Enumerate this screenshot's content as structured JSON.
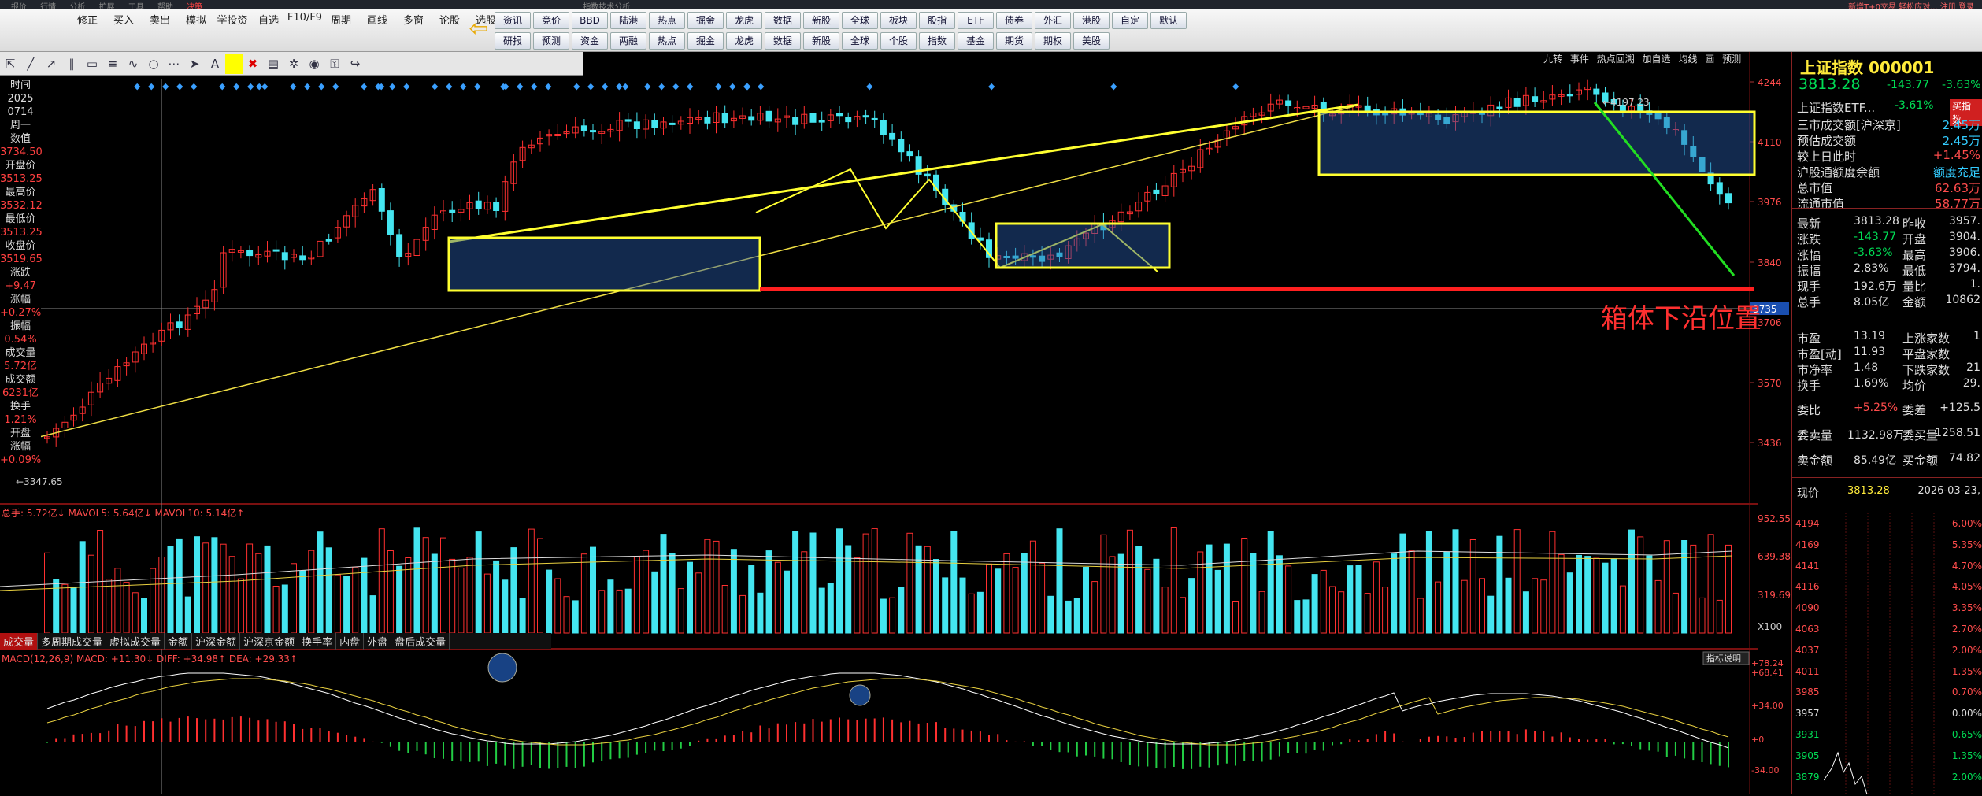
{
  "menubar": {
    "items": [
      "报价",
      "行情",
      "分析",
      "扩展",
      "工具",
      "帮助",
      "决策"
    ],
    "right": "新增T+0交易  轻松应对...   注册  登录",
    "title": "指数技术分析"
  },
  "toolbar": {
    "main": [
      "修正",
      "买入",
      "卖出",
      "模拟",
      "学投资",
      "自选",
      "F10/F9",
      "周期",
      "画线",
      "多窗",
      "论股",
      "选股"
    ],
    "quick_row1": [
      "资讯",
      "竞价",
      "BBD",
      "陆港",
      "热点",
      "掘金",
      "龙虎",
      "数据",
      "新股",
      "全球",
      "板块",
      "股指",
      "ETF",
      "债券",
      "外汇",
      "港股",
      "自定",
      "默认"
    ],
    "quick_row2": [
      "研报",
      "预测",
      "资金",
      "两融",
      "热点",
      "掘金",
      "龙虎",
      "数据",
      "新股",
      "全球",
      "个股",
      "指数",
      "基金",
      "期货",
      "期权",
      "美股"
    ]
  },
  "chart_tabs": [
    "九转",
    "事件",
    "热点回溯",
    "加自选",
    "均线",
    "画",
    "预测"
  ],
  "info_panel": [
    {
      "label": "时间",
      "value": "2025"
    },
    {
      "label": "",
      "value": "0714"
    },
    {
      "label": "周一",
      "value": ""
    },
    {
      "label": "数值",
      "value": "3734.50"
    },
    {
      "label": "开盘价",
      "value": "3513.25"
    },
    {
      "label": "最高价",
      "value": "3532.12"
    },
    {
      "label": "最低价",
      "value": "3513.25"
    },
    {
      "label": "收盘价",
      "value": "3519.65"
    },
    {
      "label": "涨跌",
      "value": "+9.47"
    },
    {
      "label": "涨幅",
      "value": "+0.27%"
    },
    {
      "label": "振幅",
      "value": "0.54%"
    },
    {
      "label": "成交量",
      "value": "5.72亿"
    },
    {
      "label": "成交额",
      "value": "6231亿"
    },
    {
      "label": "换手",
      "value": "1.21%"
    },
    {
      "label": "开盘",
      "value": ""
    },
    {
      "label": "涨幅",
      "value": "+0.09%"
    }
  ],
  "price_axis": [
    "4244",
    "4110",
    "3976",
    "3840",
    "3706",
    "3570",
    "3436"
  ],
  "crosshair_price": "3735",
  "low_label": "3347.65",
  "high_label": "4197.23",
  "annotation": "箱体下沿位置",
  "volume_header": "总手: 5.72亿↓  MAVOL5: 5.64亿↓  MAVOL10: 5.14亿↑",
  "volume_axis": [
    "952.55万",
    "639.38万",
    "319.69万",
    "X100"
  ],
  "volume_tabs": [
    "成交量",
    "多周期成交量",
    "虚拟成交量",
    "金额",
    "沪深金额",
    "沪深京金额",
    "换手率",
    "内盘",
    "外盘",
    "盘后成交量"
  ],
  "macd_header": "MACD(12,26,9)  MACD: +11.30↓  DIFF: +34.98↑  DEA: +29.33↑",
  "macd_button": "指标说明",
  "macd_axis": [
    "+78.24",
    "+68.41",
    "+34.00",
    "+0",
    "-34.00"
  ],
  "right_panel": {
    "title": "上证指数 000001",
    "price": "3813.28",
    "change": "-143.77",
    "pct": "-3.63%",
    "etf_label": "上证指数ETF...",
    "etf_pct": "-3.61%",
    "etf_btn": "买指数",
    "rows1": [
      [
        "三市成交额[沪深京]",
        "2.45万"
      ],
      [
        "预估成交额",
        "2.45万"
      ],
      [
        "较上日此时",
        "+1.45%"
      ],
      [
        "沪股通额度余额",
        "额度充足"
      ],
      [
        "总市值",
        "62.63万"
      ],
      [
        "流通市值",
        "58.77万"
      ]
    ],
    "quote": [
      [
        "最新",
        "3813.28",
        "昨收",
        "3957."
      ],
      [
        "涨跌",
        "-143.77",
        "开盘",
        "3904."
      ],
      [
        "涨幅",
        "-3.63%",
        "最高",
        "3906."
      ],
      [
        "振幅",
        "2.83%",
        "最低",
        "3794."
      ],
      [
        "现手",
        "192.6万",
        "量比",
        "1."
      ],
      [
        "总手",
        "8.05亿",
        "金额",
        "10862"
      ]
    ],
    "stats": [
      [
        "市盈",
        "13.19",
        "上涨家数",
        "1"
      ],
      [
        "市盈[动]",
        "11.93",
        "平盘家数",
        ""
      ],
      [
        "市净率",
        "1.48",
        "下跌家数",
        "21"
      ],
      [
        "换手",
        "1.69%",
        "均价",
        "29."
      ]
    ],
    "order": [
      [
        "委比",
        "+5.25%",
        "委差",
        "+125.5"
      ],
      [
        "委卖量",
        "1132.98万",
        "委买量",
        "1258.51"
      ],
      [
        "卖金额",
        "85.49亿",
        "买金额",
        "74.82"
      ]
    ],
    "now_label": "现价",
    "now_price": "3813.28",
    "date": "2026-03-23,",
    "mini_axis": [
      "4194",
      "4169",
      "4141",
      "4116",
      "4090",
      "4063",
      "4037",
      "4011",
      "3985",
      "3957",
      "3931",
      "3905",
      "3879"
    ],
    "mini_pct": [
      "6.00%",
      "5.35%",
      "4.70%",
      "4.05%",
      "3.35%",
      "2.70%",
      "2.00%",
      "1.35%",
      "0.70%",
      "0.00%",
      "0.65%",
      "1.35%",
      "2.00%"
    ]
  },
  "colors": {
    "up": "#ff3030",
    "down": "#44e5f0",
    "box": "#ffff30",
    "macd_up": "#ff3030",
    "macd_down": "#22cc44"
  }
}
